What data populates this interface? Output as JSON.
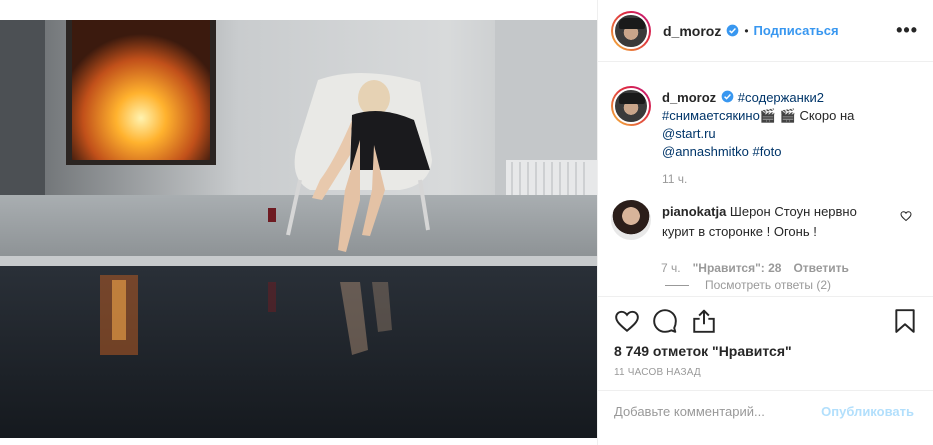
{
  "author": {
    "username": "d_moroz",
    "follow_label": "Подписаться",
    "separator": "•",
    "more_label": "•••"
  },
  "caption": {
    "username": "d_moroz",
    "line1": "#содержанки2",
    "line2_tag": "#снимаетсякино",
    "line2_rest": "🎬 🎬 Скоро на",
    "line3": "@start.ru",
    "line4_mention": "@annashmitko",
    "line4_tag": "#foto",
    "time": "11 ч."
  },
  "comment": {
    "username": "pianokatja",
    "text": "Шерон Стоун нервно курит в сторонке ! Огонь !",
    "time": "7 ч.",
    "likes": "\"Нравится\": 28",
    "reply_label": "Ответить",
    "view_replies": "Посмотреть ответы (2)"
  },
  "stats": {
    "likes": "8 749 отметок \"Нравится\"",
    "posted_ago": "11 ЧАСОВ НАЗАД"
  },
  "comment_input": {
    "placeholder": "Добавьте комментарий...",
    "publish_label": "Опубликовать"
  },
  "icons": {
    "like": "heart-icon",
    "comment": "comment-icon",
    "share": "share-icon",
    "save": "bookmark-icon",
    "verified": "verified-badge-icon"
  },
  "colors": {
    "link": "#3897f0",
    "tag": "#003569",
    "muted": "#999999",
    "publish_disabled": "#b2dffc"
  }
}
